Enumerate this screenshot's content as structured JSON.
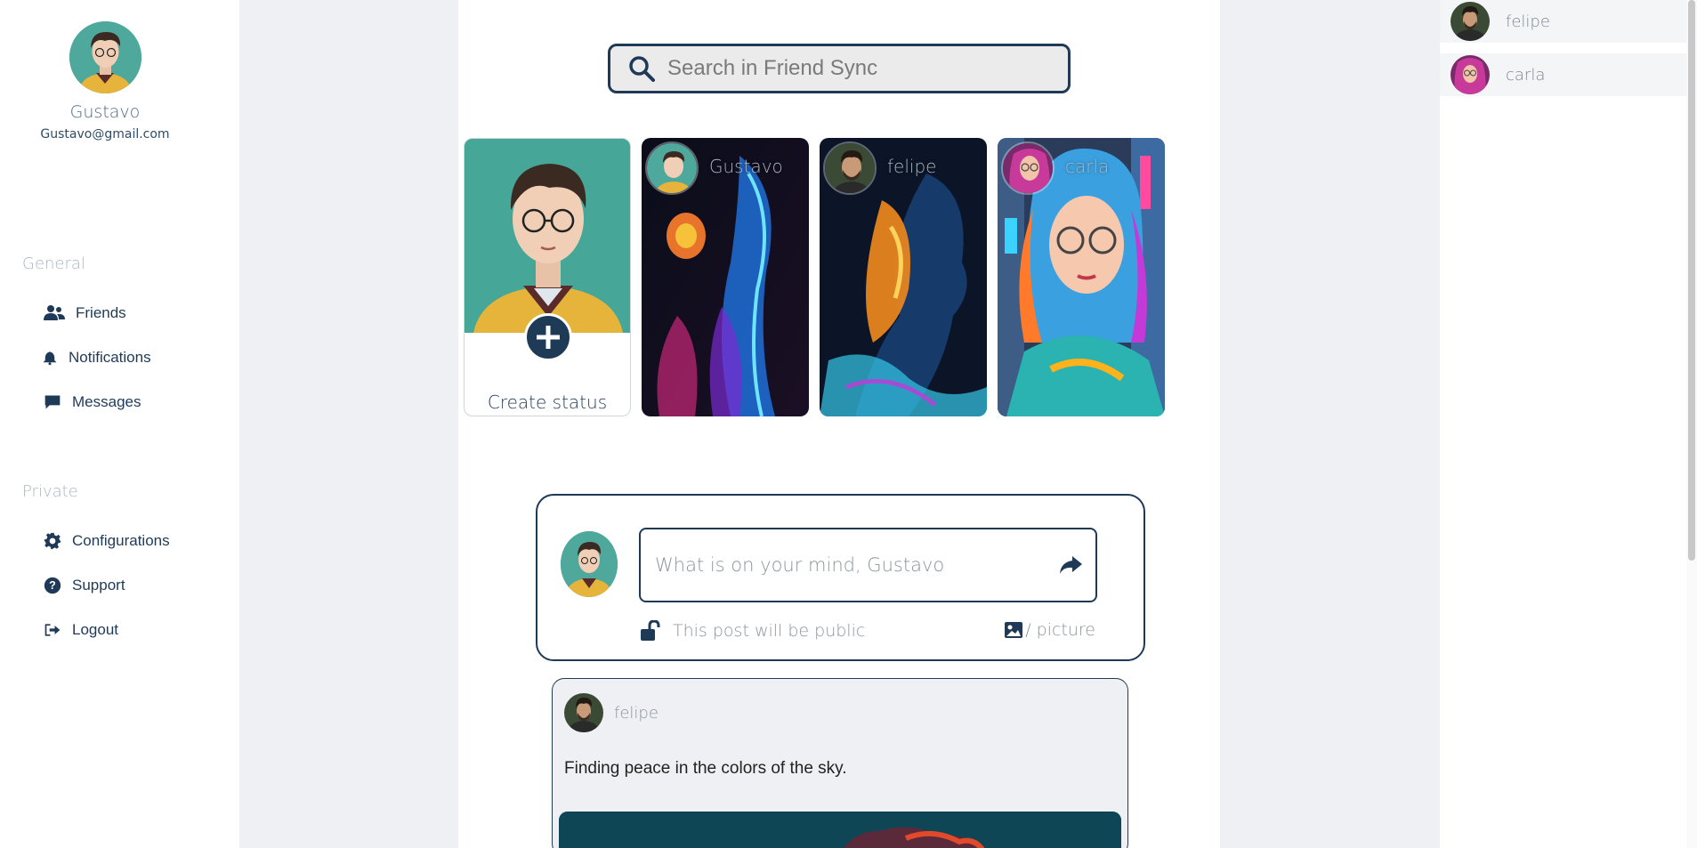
{
  "user": {
    "name": "Gustavo",
    "email": "Gustavo@gmail.com"
  },
  "nav": {
    "general_title": "General",
    "general_items": [
      {
        "label": "Friends",
        "icon": "users-icon"
      },
      {
        "label": "Notifications",
        "icon": "bell-icon"
      },
      {
        "label": "Messages",
        "icon": "message-icon"
      }
    ],
    "private_title": "Private",
    "private_items": [
      {
        "label": "Configurations",
        "icon": "gear-icon"
      },
      {
        "label": "Support",
        "icon": "question-icon"
      },
      {
        "label": "Logout",
        "icon": "logout-icon"
      }
    ]
  },
  "search": {
    "placeholder": "Search in Friend Sync"
  },
  "stories": {
    "create_label": "Create status",
    "items": [
      {
        "name": "Gustavo"
      },
      {
        "name": "felipe"
      },
      {
        "name": "carla"
      }
    ]
  },
  "composer": {
    "placeholder": "What is on your mind, Gustavo",
    "privacy_text": "This post will be public",
    "picture_label": "/ picture"
  },
  "post": {
    "author": "felipe",
    "text": "Finding peace in the colors of the sky."
  },
  "contacts": [
    {
      "name": "felipe"
    },
    {
      "name": "carla"
    }
  ],
  "colors": {
    "accent": "#1f3a57",
    "background": "#eef0f3"
  }
}
